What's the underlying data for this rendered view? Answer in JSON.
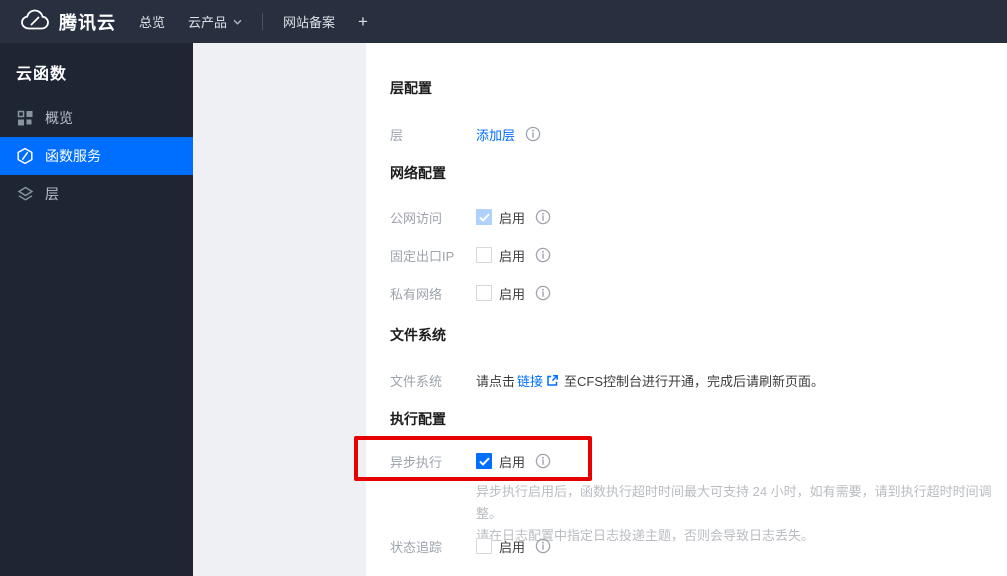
{
  "topbar": {
    "brand": "腾讯云",
    "menu_overview": "总览",
    "menu_products": "云产品",
    "menu_beian": "网站备案",
    "menu_plus": "+"
  },
  "sidebar": {
    "title": "云函数",
    "items": [
      {
        "label": "概览",
        "icon": "grid-icon",
        "active": false
      },
      {
        "label": "函数服务",
        "icon": "function-icon",
        "active": true
      },
      {
        "label": "层",
        "icon": "layers-icon",
        "active": false
      }
    ]
  },
  "main": {
    "layer_config": {
      "heading": "层配置",
      "layer_label": "层",
      "add_layer_link": "添加层"
    },
    "network_config": {
      "heading": "网络配置",
      "public_access": {
        "label": "公网访问",
        "enable": "启用",
        "state": "checked-disabled"
      },
      "fixed_ip": {
        "label": "固定出口IP",
        "enable": "启用",
        "state": "unchecked"
      },
      "private_network": {
        "label": "私有网络",
        "enable": "启用",
        "state": "unchecked"
      }
    },
    "file_system": {
      "heading": "文件系统",
      "label": "文件系统",
      "text_before": "请点击",
      "link": "链接",
      "text_after": "至CFS控制台进行开通，完成后请刷新页面。"
    },
    "execution_config": {
      "heading": "执行配置",
      "async_execution": {
        "label": "异步执行",
        "enable": "启用",
        "state": "checked"
      },
      "async_note_line1": "异步执行启用后，函数执行超时时间最大可支持 24 小时，如有需要，请到执行超时时间调整。",
      "async_note_line2": "请在日志配置中指定日志投递主题，否则会导致日志丢失。",
      "status_tracking": {
        "label": "状态追踪",
        "enable": "启用",
        "state": "unchecked"
      }
    }
  },
  "colors": {
    "accent_blue": "#006eff",
    "topbar_bg": "#28303f",
    "sidebar_bg": "#1f2633",
    "highlight_red": "#e60000",
    "disabled_check_blue": "#aed2fb"
  }
}
